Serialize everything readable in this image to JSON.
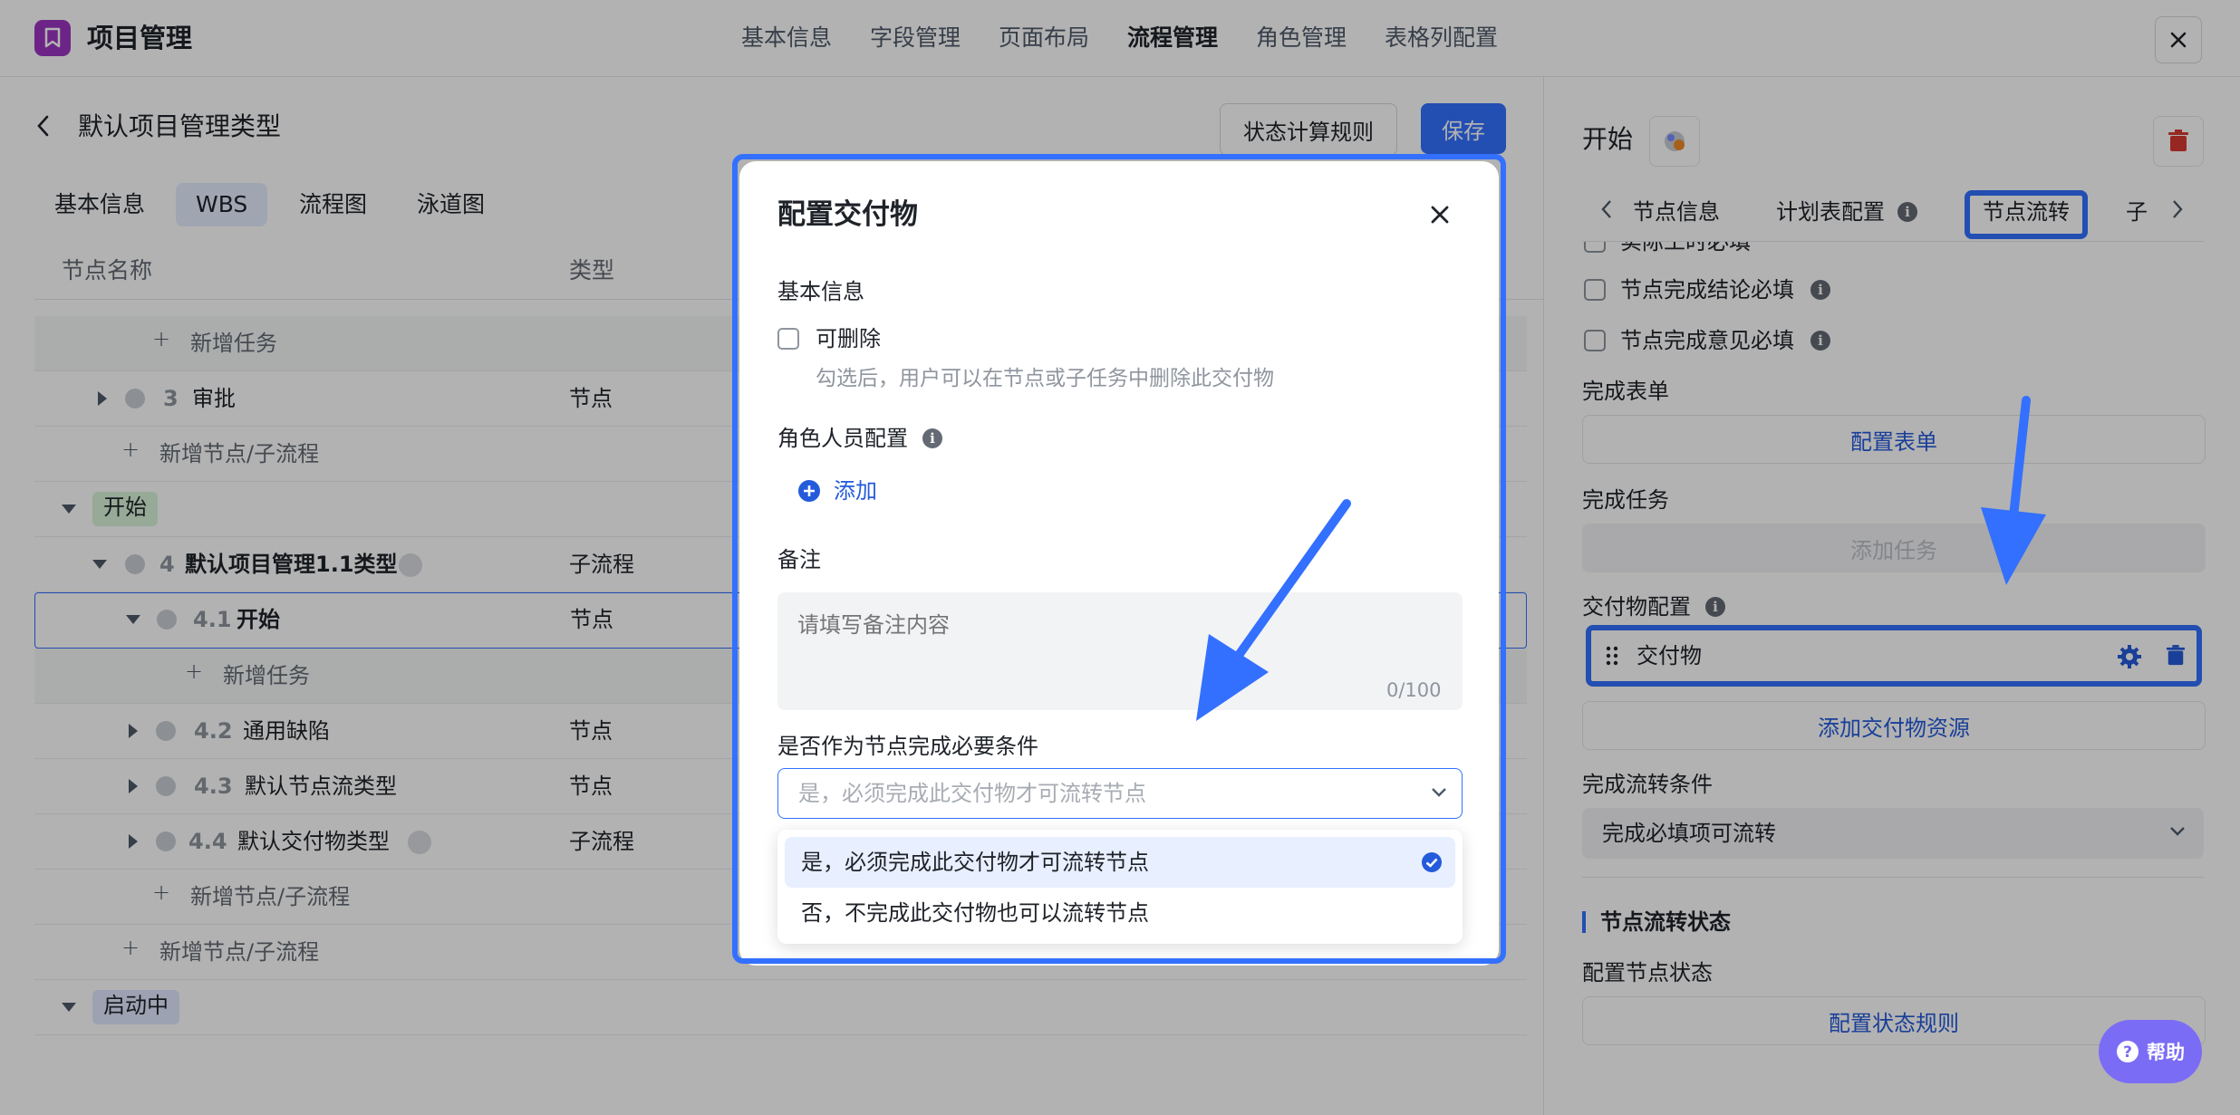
{
  "topbar": {
    "title": "项目管理",
    "nav": [
      "基本信息",
      "字段管理",
      "页面布局",
      "流程管理",
      "角色管理",
      "表格列配置"
    ],
    "active_nav": "流程管理"
  },
  "left": {
    "page_title": "默认项目管理类型",
    "state_rule_button": "状态计算规则",
    "save_button": "保存",
    "subtabs": [
      "基本信息",
      "WBS",
      "流程图",
      "泳道图"
    ],
    "col_name": "节点名称",
    "col_type": "类型",
    "rows": {
      "add_task_1": "新增任务",
      "approve_num": "3",
      "approve_name": "审批",
      "approve_type": "节点",
      "add_node_1": "新增节点/子流程",
      "start_tag": "开始",
      "r4_num": "4",
      "r4_name": "默认项目管理1.1类型",
      "r4_type": "子流程",
      "r41_num": "4.1",
      "r41_name": "开始",
      "r41_type": "节点",
      "add_task_2": "新增任务",
      "r42_num": "4.2",
      "r42_name": "通用缺陷",
      "r42_type": "节点",
      "r43_num": "4.3",
      "r43_name": "默认节点流类型",
      "r43_type": "节点",
      "r44_num": "4.4",
      "r44_name": "默认交付物类型",
      "r44_type": "子流程",
      "add_node_2": "新增节点/子流程",
      "add_node_3": "新增节点/子流程",
      "starting_tag": "启动中"
    }
  },
  "right": {
    "title": "开始",
    "tabs": [
      "节点信息",
      "计划表配置",
      "节点流转",
      "子"
    ],
    "active_tab": "节点流转",
    "cut_checkbox": "实际工时必填",
    "cb1": "节点完成结论必填",
    "cb2": "节点完成意见必填",
    "form_label": "完成表单",
    "form_button": "配置表单",
    "task_label": "完成任务",
    "task_button": "添加任务",
    "deliv_label": "交付物配置",
    "deliv_item": "交付物",
    "add_deliv_button": "添加交付物资源",
    "cond_label": "完成流转条件",
    "cond_value": "完成必填项可流转",
    "state_section": "节点流转状态",
    "state_label": "配置节点状态",
    "state_button": "配置状态规则"
  },
  "modal": {
    "title": "配置交付物",
    "basic_label": "基本信息",
    "deletable_label": "可删除",
    "deletable_hint": "勾选后，用户可以在节点或子任务中删除此交付物",
    "role_label": "角色人员配置",
    "add_label": "添加",
    "remark_label": "备注",
    "remark_placeholder": "请填写备注内容",
    "remark_count": "0/100",
    "required_label": "是否作为节点完成必要条件",
    "select_placeholder": "是，必须完成此交付物才可流转节点",
    "options": [
      "是，必须完成此交付物才可流转节点",
      "否，不完成此交付物也可以流转节点"
    ]
  },
  "help": {
    "label": "帮助"
  },
  "colors": {
    "accent": "#3370ff",
    "highlight_border": "#3370ff",
    "brand_logo": "#9b36c2",
    "danger": "#d83931"
  }
}
